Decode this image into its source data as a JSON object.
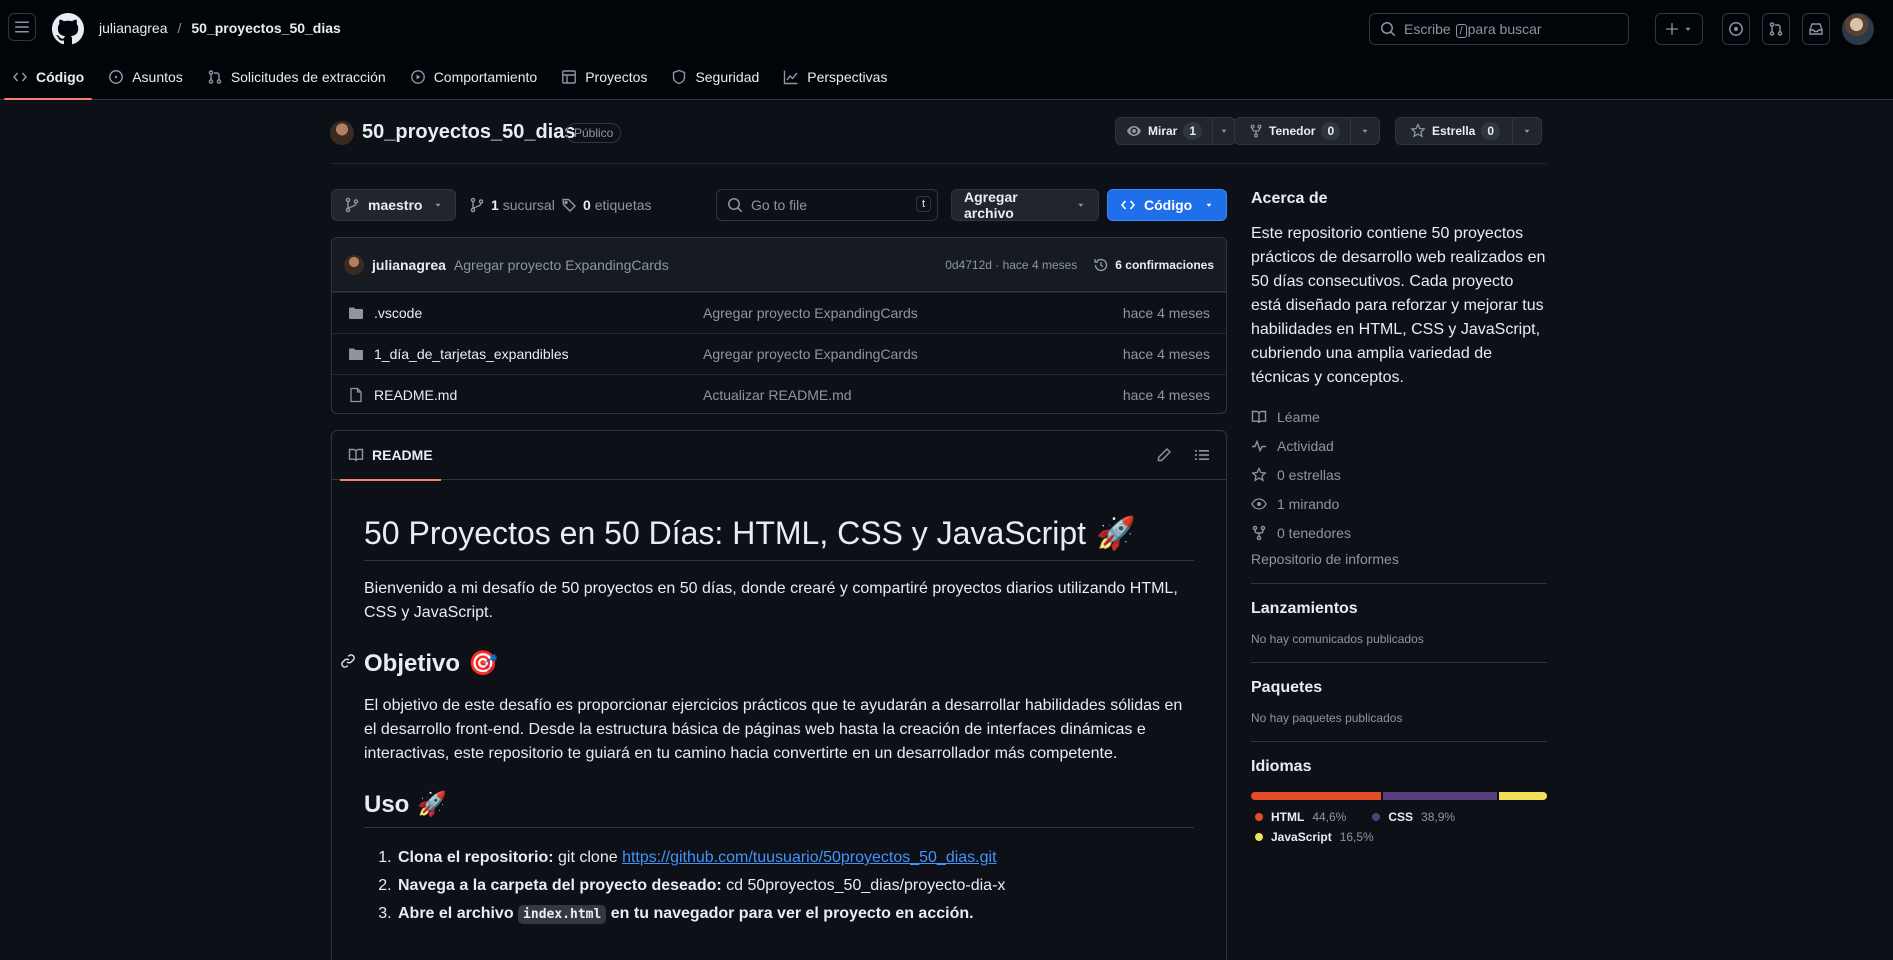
{
  "header": {
    "owner": "julianagrea",
    "repo": "50_proyectos_50_dias",
    "search_prefix": "Escribe",
    "search_key": "/",
    "search_suffix": "para buscar"
  },
  "tabs": [
    {
      "label": "Código",
      "icon": "code-icon",
      "active": true
    },
    {
      "label": "Asuntos",
      "icon": "issue-icon"
    },
    {
      "label": "Solicitudes de extracción",
      "icon": "pull-request-icon"
    },
    {
      "label": "Comportamiento",
      "icon": "actions-icon"
    },
    {
      "label": "Proyectos",
      "icon": "table-icon"
    },
    {
      "label": "Seguridad",
      "icon": "shield-icon"
    },
    {
      "label": "Perspectivas",
      "icon": "graph-icon"
    }
  ],
  "repo": {
    "name": "50_proyectos_50_dias",
    "visibility": "Público",
    "watch_label": "Mirar",
    "watch_count": "1",
    "fork_label": "Tenedor",
    "fork_count": "0",
    "star_label": "Estrella",
    "star_count": "0"
  },
  "filenav": {
    "branch": "maestro",
    "branches_count": "1",
    "branches_label": "sucursal",
    "tags_count": "0",
    "tags_label": "etiquetas",
    "goto_placeholder": "Go to file",
    "goto_key": "t",
    "add_file": "Agregar archivo",
    "code": "Código"
  },
  "commit": {
    "author": "julianagrea",
    "message": "Agregar proyecto ExpandingCards",
    "hash_age": "0d4712d · hace 4 meses",
    "count_label": "6 confirmaciones"
  },
  "files": [
    {
      "name": ".vscode",
      "type": "folder",
      "commit": "Agregar proyecto ExpandingCards",
      "age": "hace 4 meses"
    },
    {
      "name": "1_día_de_tarjetas_expandibles",
      "type": "folder",
      "commit": "Agregar proyecto ExpandingCards",
      "age": "hace 4 meses"
    },
    {
      "name": "README.md",
      "type": "file",
      "commit": "Actualizar README.md",
      "age": "hace 4 meses"
    }
  ],
  "readme": {
    "tab": "README",
    "h1": "50 Proyectos en 50 Días: HTML, CSS y JavaScript",
    "h1_emoji": "🚀",
    "intro": "Bienvenido a mi desafío de 50 proyectos en 50 días, donde crearé y compartiré proyectos diarios utilizando HTML, CSS y JavaScript.",
    "h2_objetivo": "Objetivo",
    "objetivo_emoji": "🎯",
    "objetivo_text": "El objetivo de este desafío es proporcionar ejercicios prácticos que te ayudarán a desarrollar habilidades sólidas en el desarrollo front-end. Desde la estructura básica de páginas web hasta la creación de interfaces dinámicas e interactivas, este repositorio te guiará en tu camino hacia convertirte en un desarrollador más competente.",
    "h2_uso": "Uso",
    "uso_emoji": "🚀",
    "step1_bold": "Clona el repositorio:",
    "step1_text": " git clone ",
    "step1_link": "https://github.com/tuusuario/50proyectos_50_dias.git",
    "step2_bold": "Navega a la carpeta del proyecto deseado:",
    "step2_text": " cd 50proyectos_50_dias/proyecto-dia-x",
    "step3_bold_a": "Abre el archivo ",
    "step3_code": "index.html",
    "step3_bold_b": " en tu navegador para ver el proyecto en acción."
  },
  "sidebar": {
    "about_title": "Acerca de",
    "description": "Este repositorio contiene 50 proyectos prácticos de desarrollo web realizados en 50 días consecutivos. Cada proyecto está diseñado para reforzar y mejorar tus habilidades en HTML, CSS y JavaScript, cubriendo una amplia variedad de técnicas y conceptos.",
    "links": [
      {
        "label": "Léame",
        "icon": "book-icon"
      },
      {
        "label": "Actividad",
        "icon": "pulse-icon"
      },
      {
        "label": "0 estrellas",
        "icon": "star-icon"
      },
      {
        "label": "1 mirando",
        "icon": "eye-icon"
      },
      {
        "label": "0 tenedores",
        "icon": "fork-icon"
      }
    ],
    "report": "Repositorio de informes",
    "releases_title": "Lanzamientos",
    "releases_empty": "No hay comunicados publicados",
    "packages_title": "Paquetes",
    "packages_empty": "No hay paquetes publicados",
    "languages_title": "Idiomas",
    "languages": [
      {
        "name": "HTML",
        "pct_label": "44,6%",
        "pct": 44.6,
        "color": "#e34c26"
      },
      {
        "name": "CSS",
        "pct_label": "38,9%",
        "pct": 38.9,
        "color": "#563d7c"
      },
      {
        "name": "JavaScript",
        "pct_label": "16,5%",
        "pct": 16.5,
        "color": "#f1e05a"
      }
    ]
  }
}
